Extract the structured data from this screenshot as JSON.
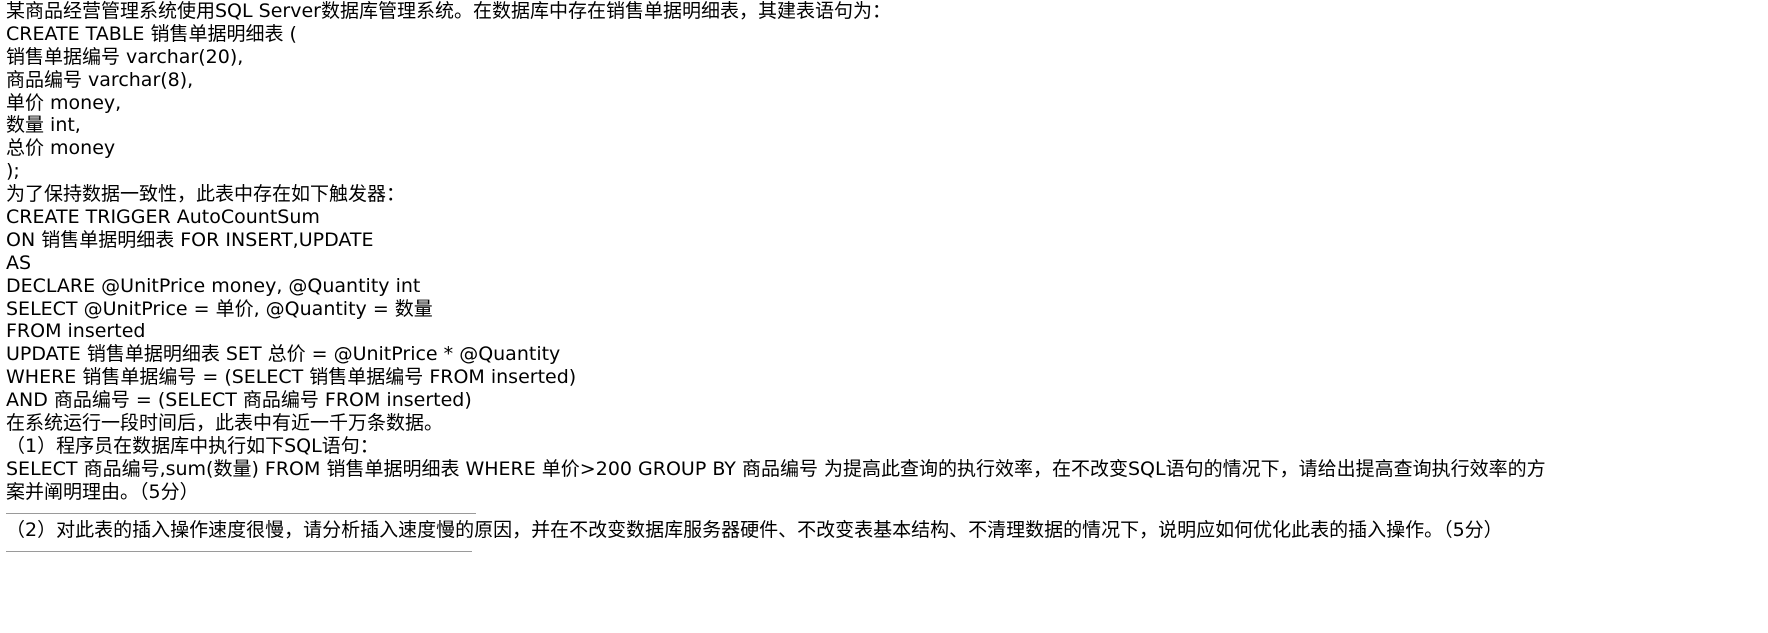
{
  "intro": "某商品经营管理系统使用SQL Server数据库管理系统。在数据库中存在销售单据明细表，其建表语句为：",
  "create_table": [
    "CREATE TABLE 销售单据明细表 (",
    "销售单据编号 varchar(20),",
    "商品编号 varchar(8),",
    "单价 money,",
    "数量 int,",
    "总价 money",
    ");"
  ],
  "trigger_intro": "为了保持数据一致性，此表中存在如下触发器：",
  "trigger": [
    "CREATE TRIGGER AutoCountSum",
    "ON 销售单据明细表 FOR INSERT,UPDATE",
    "AS",
    "DECLARE @UnitPrice money, @Quantity int",
    "SELECT @UnitPrice = 单价, @Quantity = 数量",
    "FROM inserted",
    "UPDATE 销售单据明细表 SET 总价 = @UnitPrice * @Quantity",
    "WHERE 销售单据编号 = (SELECT 销售单据编号 FROM inserted)",
    "AND 商品编号 = (SELECT 商品编号 FROM inserted)"
  ],
  "context": "在系统运行一段时间后，此表中有近一千万条数据。",
  "q1_intro": "（1）程序员在数据库中执行如下SQL语句：",
  "q1_text": "SELECT 商品编号,sum(数量) FROM 销售单据明细表 WHERE 单价>200 GROUP BY 商品编号 为提高此查询的执行效率，在不改变SQL语句的情况下，请给出提高查询执行效率的方案并阐明理由。（5分）",
  "q2_text": "（2）对此表的插入操作速度很慢，请分析插入速度慢的原因，并在不改变数据库服务器硬件、不改变表基本结构、不清理数据的情况下，说明应如何优化此表的插入操作。（5分）"
}
